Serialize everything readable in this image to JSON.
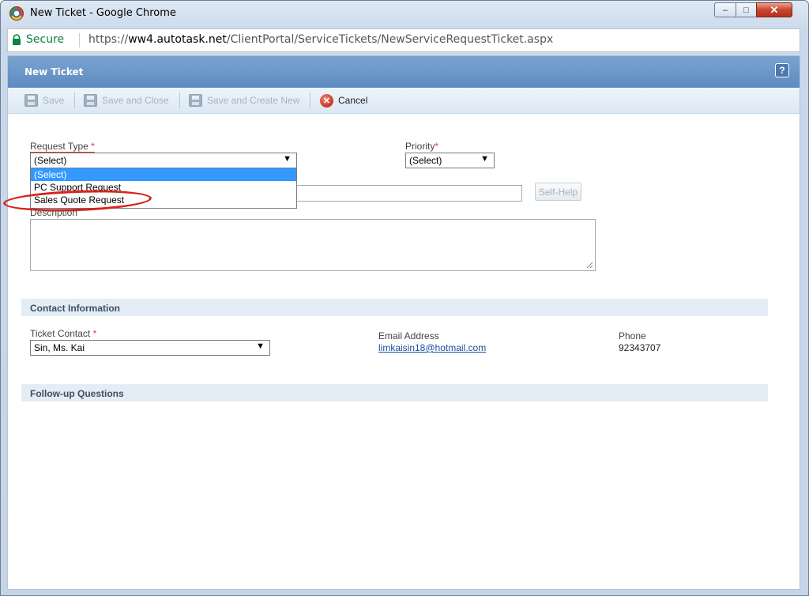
{
  "window": {
    "title": "New Ticket - Google Chrome",
    "controls": {
      "minimize": "–",
      "maximize": "□",
      "close": "✕"
    }
  },
  "address_bar": {
    "secure_label": "Secure",
    "url_prefix": "https://",
    "url_host": "ww4.autotask.net",
    "url_path": "/ClientPortal/ServiceTickets/NewServiceRequestTicket.aspx"
  },
  "header": {
    "title": "New Ticket",
    "help_icon": "?"
  },
  "toolbar": {
    "save_label": "Save",
    "save_close_label": "Save and Close",
    "save_create_new_label": "Save and Create New",
    "cancel_label": "Cancel"
  },
  "form": {
    "request_type": {
      "label": "Request Type",
      "required_mark": "*",
      "selected": "(Select)",
      "options": [
        "(Select)",
        "PC Support Request",
        "Sales Quote Request"
      ]
    },
    "priority": {
      "label": "Priority",
      "required_mark": "*",
      "selected": "(Select)"
    },
    "self_help_label": "Self-Help",
    "description_label": "Description"
  },
  "contact": {
    "section_title": "Contact Information",
    "ticket_contact_label": "Ticket Contact",
    "required_mark": "*",
    "ticket_contact_value": "Sin, Ms. Kai",
    "email_label": "Email Address",
    "email_value": "limkaisin18@hotmail.com",
    "phone_label": "Phone",
    "phone_value": "92343707"
  },
  "followup": {
    "section_title": "Follow-up Questions"
  },
  "colors": {
    "header_blue": "#5d8bc1",
    "highlight_red": "#d9231c",
    "selected_option": "#3399ff"
  }
}
